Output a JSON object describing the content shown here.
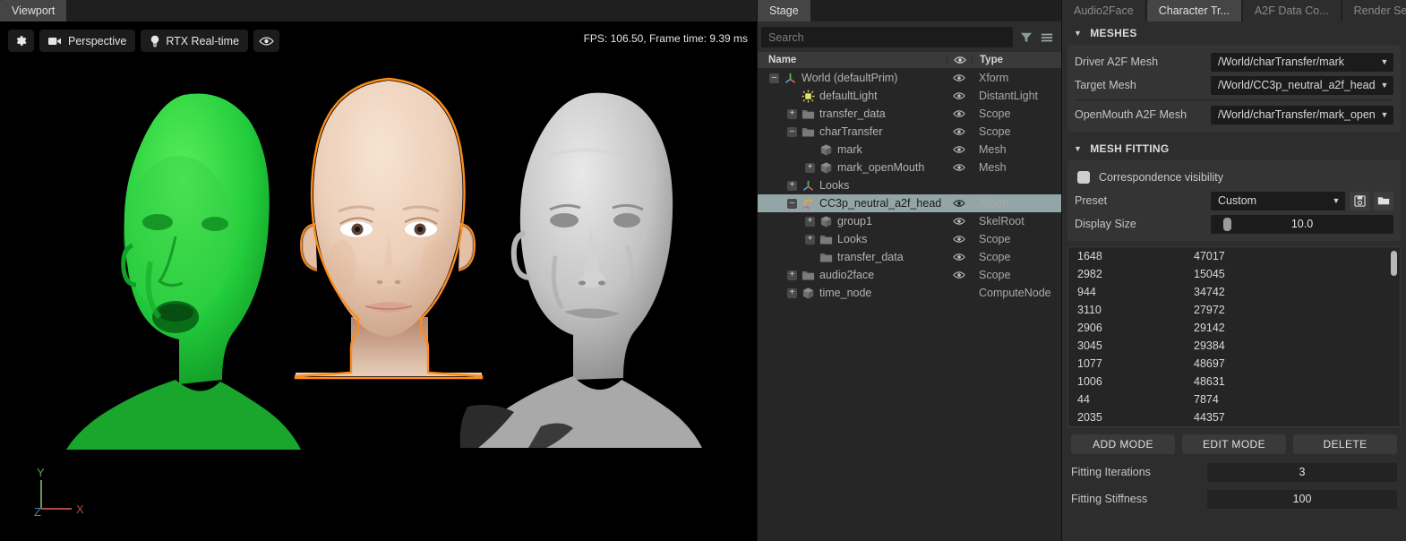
{
  "viewport": {
    "tab_label": "Viewport",
    "toolbar": {
      "settings_icon": "gear-icon",
      "camera_label": "Perspective",
      "camera_icon": "video-camera-icon",
      "renderer_label": "RTX Real-time",
      "renderer_icon": "lightbulb-icon",
      "visibility_icon": "eye-icon"
    },
    "stats": "FPS: 106.50, Frame time: 9.39 ms",
    "axis": {
      "x": "X",
      "y": "Y",
      "z": "Z",
      "x_color": "#b24a3f",
      "y_color": "#5f9e4f",
      "z_color": "#4f7fbf"
    }
  },
  "stage": {
    "tab_label": "Stage",
    "search_placeholder": "Search",
    "filter_icon": "funnel-filter-icon",
    "menu_icon": "hamburger-menu-icon",
    "columns": {
      "name": "Name",
      "eye": "eye-icon",
      "type": "Type"
    },
    "rows": [
      {
        "label": "World (defaultPrim)",
        "type": "Xform",
        "depth": 0,
        "expander": "minus",
        "icon": "xform-axis-icon",
        "eye": true,
        "selected": false
      },
      {
        "label": "defaultLight",
        "type": "DistantLight",
        "depth": 1,
        "expander": "none",
        "icon": "light-icon",
        "eye": true,
        "selected": false
      },
      {
        "label": "transfer_data",
        "type": "Scope",
        "depth": 1,
        "expander": "plus",
        "icon": "folder-icon",
        "eye": true,
        "selected": false
      },
      {
        "label": "charTransfer",
        "type": "Scope",
        "depth": 1,
        "expander": "minus",
        "icon": "folder-icon",
        "eye": true,
        "selected": false
      },
      {
        "label": "mark",
        "type": "Mesh",
        "depth": 2,
        "expander": "none",
        "icon": "mesh-cube-icon",
        "eye": true,
        "selected": false
      },
      {
        "label": "mark_openMouth",
        "type": "Mesh",
        "depth": 2,
        "expander": "plus",
        "icon": "mesh-cube-icon",
        "eye": true,
        "selected": false
      },
      {
        "label": "Looks",
        "type": "",
        "depth": 1,
        "expander": "plus",
        "icon": "xform-axis-icon",
        "eye": false,
        "selected": false
      },
      {
        "label": "CC3p_neutral_a2f_head",
        "type": "Xform",
        "depth": 1,
        "expander": "minus",
        "icon": "anim-xform-icon",
        "eye": true,
        "selected": true
      },
      {
        "label": "group1",
        "type": "SkelRoot",
        "depth": 2,
        "expander": "plus",
        "icon": "mesh-cube-icon",
        "eye": true,
        "selected": false
      },
      {
        "label": "Looks",
        "type": "Scope",
        "depth": 2,
        "expander": "plus",
        "icon": "folder-icon",
        "eye": true,
        "selected": false
      },
      {
        "label": "transfer_data",
        "type": "Scope",
        "depth": 2,
        "expander": "none",
        "icon": "folder-icon",
        "eye": true,
        "selected": false
      },
      {
        "label": "audio2face",
        "type": "Scope",
        "depth": 1,
        "expander": "plus",
        "icon": "folder-icon",
        "eye": true,
        "selected": false
      },
      {
        "label": "time_node",
        "type": "ComputeNode",
        "depth": 1,
        "expander": "plus",
        "icon": "mesh-cube-icon",
        "eye": false,
        "selected": false
      }
    ]
  },
  "properties": {
    "tabs": [
      {
        "label": "Audio2Face",
        "active": false
      },
      {
        "label": "Character Tr...",
        "active": true
      },
      {
        "label": "A2F Data Co...",
        "active": false
      },
      {
        "label": "Render Settin...",
        "active": false
      }
    ],
    "meshes": {
      "title": "MESHES",
      "driver_label": "Driver A2F Mesh",
      "driver_value": "/World/charTransfer/mark",
      "target_label": "Target Mesh",
      "target_value": "/World/CC3p_neutral_a2f_head/",
      "openmouth_label": "OpenMouth A2F Mesh",
      "openmouth_value": "/World/charTransfer/mark_open"
    },
    "mesh_fitting": {
      "title": "MESH FITTING",
      "correspondence_label": "Correspondence visibility",
      "correspondence_checked": false,
      "preset_label": "Preset",
      "preset_value": "Custom",
      "save_icon": "floppy-save-icon",
      "load_icon": "folder-open-icon",
      "display_size_label": "Display Size",
      "display_size_value": "10.0",
      "correspondence_pairs": [
        [
          "1648",
          "47017"
        ],
        [
          "2982",
          "15045"
        ],
        [
          "944",
          "34742"
        ],
        [
          "3110",
          "27972"
        ],
        [
          "2906",
          "29142"
        ],
        [
          "3045",
          "29384"
        ],
        [
          "1077",
          "48697"
        ],
        [
          "1006",
          "48631"
        ],
        [
          "44",
          "7874"
        ],
        [
          "2035",
          "44357"
        ]
      ],
      "add_mode_label": "ADD MODE",
      "edit_mode_label": "EDIT MODE",
      "delete_label": "DELETE",
      "fitting_iterations_label": "Fitting Iterations",
      "fitting_iterations_value": "3",
      "fitting_stiffness_label": "Fitting Stiffness",
      "fitting_stiffness_value": "100"
    }
  }
}
